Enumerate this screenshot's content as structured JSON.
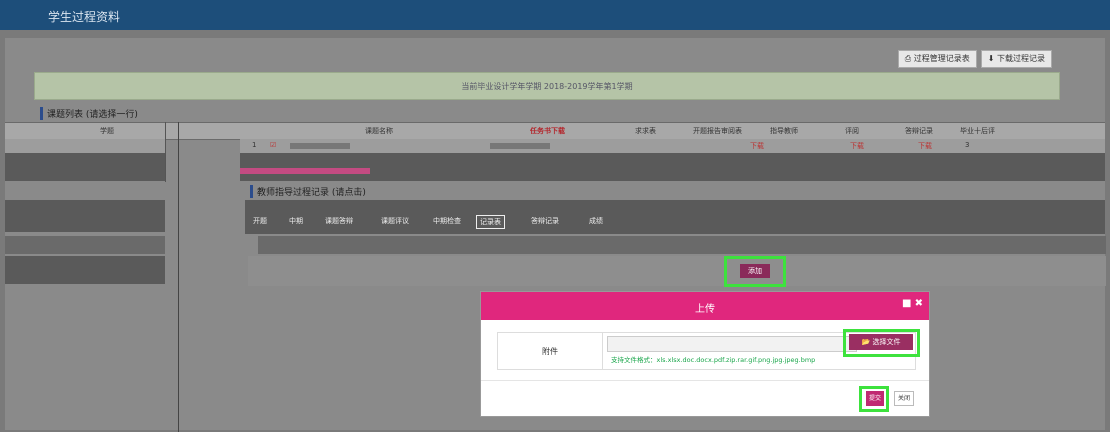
{
  "app": {
    "title": "学生过程资料"
  },
  "toolbar": {
    "manage_label": "过程管理记录表",
    "download_label": "下载过程记录"
  },
  "banner": {
    "text": "当前毕业设计学年学期 2018-2019学年第1学期"
  },
  "topic_list": {
    "heading": "课题列表 (请选择一行)",
    "columns": [
      "学题",
      "课题名称",
      "任务书下载",
      "求求表",
      "开题报告审阅表",
      "指导教师",
      "评阅",
      "答辩记录",
      "毕业十后评"
    ],
    "row": {
      "index": "1",
      "task": "下载",
      "col7": "下载",
      "col8": "下载",
      "col9": "3"
    }
  },
  "guide_record": {
    "heading": "教师指导过程记录 (请点击)",
    "tabs": [
      "开题",
      "中期",
      "课题答辩",
      "课题评议",
      "中期检查",
      "记录表",
      "答辩记录",
      "成绩"
    ]
  },
  "add_button": "添加",
  "modal": {
    "title": "上传",
    "attachment_label": "附件",
    "choose_file": "选择文件",
    "hint": "支持文件格式：xls.xlsx.doc.docx.pdf.zip.rar.gif.png.jpg.jpeg.bmp",
    "submit": "提交",
    "close": "关闭"
  },
  "colors": {
    "header_bar": "#1d4e7a",
    "modal_head": "#e0277d",
    "highlight": "#3de23d",
    "button": "#9a2f62"
  }
}
